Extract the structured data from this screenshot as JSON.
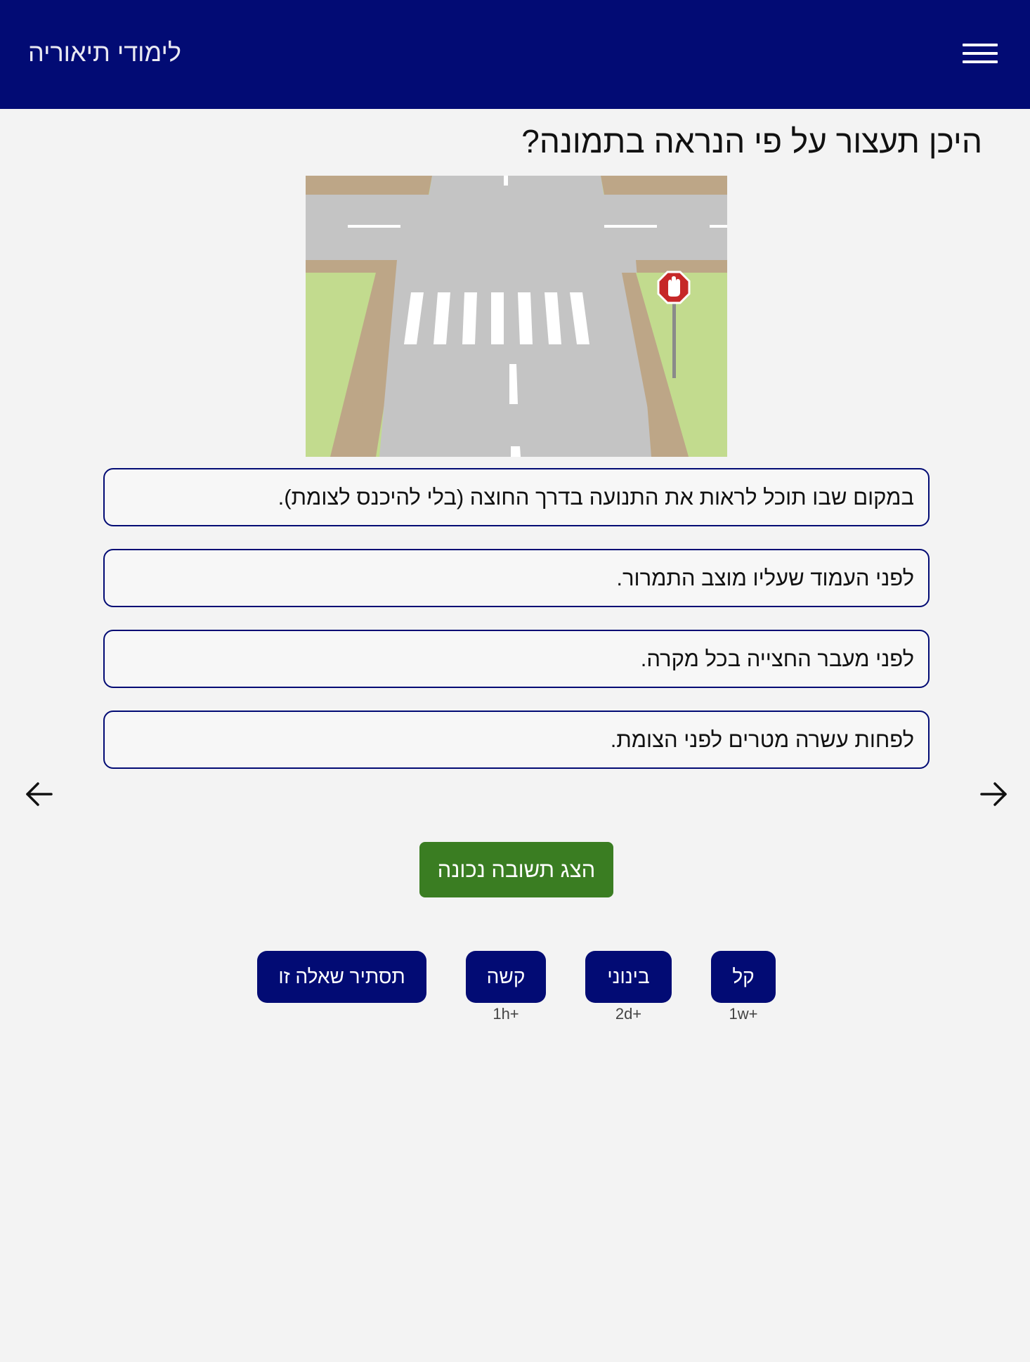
{
  "header": {
    "title": "לימודי תיאוריה",
    "menu_icon": "hamburger-menu-icon",
    "background_color": "#020b74"
  },
  "question": {
    "text": "היכן תעצור על פי הנראה בתמונה?",
    "image_icon": "intersection-stop-sign-illustration"
  },
  "answers": [
    "במקום שבו תוכל לראות את התנועה בדרך החוצה (בלי להיכנס לצומת).",
    "לפני העמוד שעליו מוצב התמרור.",
    "לפני מעבר החצייה בכל מקרה.",
    "לפחות עשרה מטרים לפני הצומת."
  ],
  "navigation": {
    "prev_icon": "arrow-left-icon",
    "next_icon": "arrow-right-icon"
  },
  "show_answer": {
    "label": "הצג תשובה נכונה",
    "color": "#3a7d22"
  },
  "difficulty": {
    "easy": {
      "label": "קל",
      "sub": "1w+"
    },
    "medium": {
      "label": "בינוני",
      "sub": "2d+"
    },
    "hard": {
      "label": "קשה",
      "sub": "1h+"
    },
    "hide": {
      "label": "תסתיר שאלה זו"
    }
  }
}
